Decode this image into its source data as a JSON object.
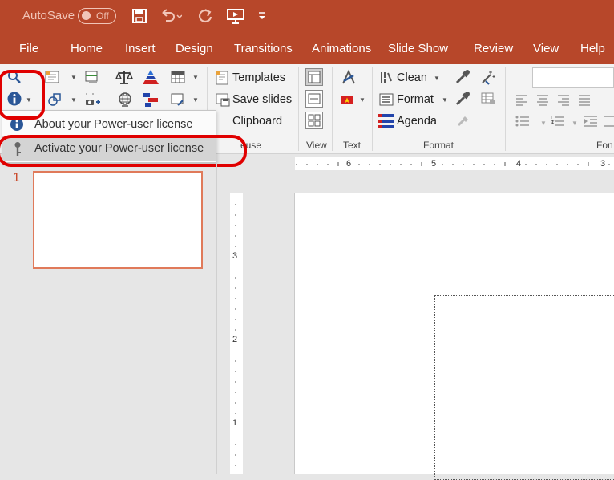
{
  "titlebar": {
    "autosave_label": "AutoSave",
    "autosave_state": "Off",
    "icons": [
      "save-icon",
      "undo-icon",
      "redo-icon",
      "slideshow-from-start-icon",
      "customize-qat-icon"
    ]
  },
  "menu": [
    "File",
    "Home",
    "Insert",
    "Design",
    "Transitions",
    "Animations",
    "Slide Show",
    "Review",
    "View",
    "Help"
  ],
  "ribbon": {
    "reuse": {
      "templates": "Templates",
      "save_slides": "Save slides",
      "clipboard": "Clipboard",
      "group_label": "euse"
    },
    "view": {
      "group_label": "View"
    },
    "text": {
      "group_label": "Text"
    },
    "format": {
      "clean": "Clean",
      "format": "Format",
      "agenda": "Agenda",
      "group_label": "Format"
    },
    "font": {
      "group_label": "Fon"
    }
  },
  "dropdown": {
    "items": [
      {
        "label": "About your Power-user license",
        "icon": "info-icon"
      },
      {
        "label": "Activate your Power-user license",
        "icon": "key-icon"
      }
    ]
  },
  "slides_pane": {
    "slide_number": "1"
  },
  "hruler": [
    "6",
    "5",
    "4",
    "3"
  ],
  "vruler": [
    "3",
    "2",
    "1"
  ],
  "colors": {
    "accent": "#b7472a",
    "annotation": "#e00000",
    "thumbnail_border": "#e07a5a"
  }
}
